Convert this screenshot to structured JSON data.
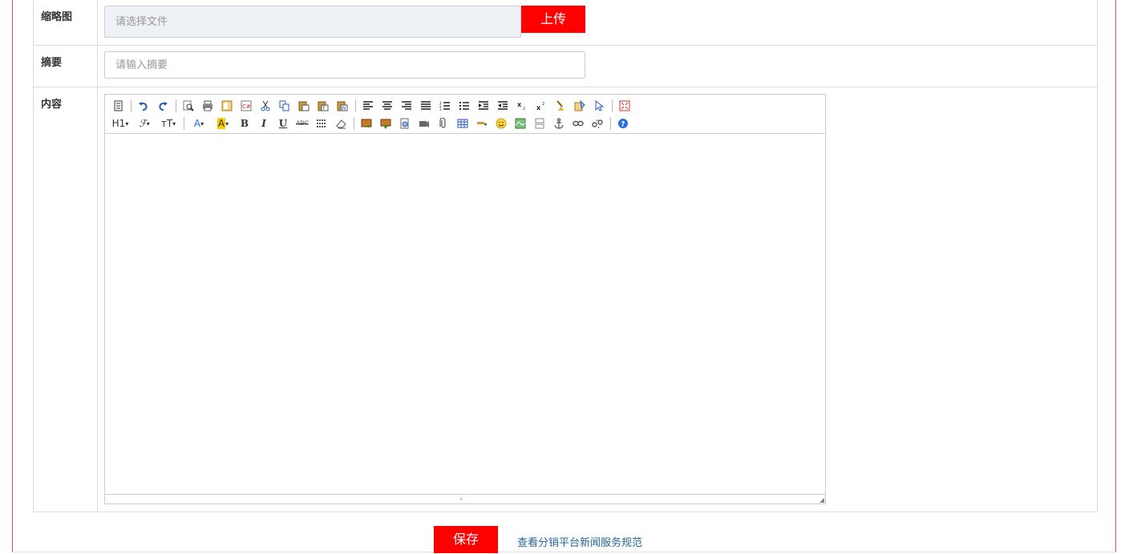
{
  "form": {
    "thumbnail": {
      "label": "缩略图",
      "placeholder": "请选择文件",
      "upload_label": "上传"
    },
    "summary": {
      "label": "摘要",
      "placeholder": "请输入摘要"
    },
    "content": {
      "label": "内容"
    }
  },
  "editor": {
    "toolbar_row1": [
      "source-icon",
      "undo-icon",
      "redo-icon",
      "preview-icon",
      "print-icon",
      "template-icon",
      "code-icon",
      "cut-icon",
      "copy-icon",
      "paste-icon",
      "paste-text-icon",
      "paste-word-icon",
      "align-left-icon",
      "align-center-icon",
      "align-right-icon",
      "justify-icon",
      "ordered-list-icon",
      "unordered-list-icon",
      "indent-icon",
      "outdent-icon",
      "subscript-icon",
      "superscript-icon",
      "clear-format-icon",
      "quick-format-icon",
      "select-all-icon",
      "fullscreen-icon"
    ],
    "toolbar_row2": [
      "heading-icon",
      "font-family-icon",
      "font-size-icon",
      "text-color-icon",
      "highlight-color-icon",
      "bold-icon",
      "italic-icon",
      "underline-icon",
      "strikethrough-icon",
      "line-height-icon",
      "eraser-icon",
      "image-icon",
      "multi-image-icon",
      "flash-icon",
      "media-icon",
      "attachment-icon",
      "table-icon",
      "horizontal-rule-icon",
      "emoticon-icon",
      "baidu-map-icon",
      "page-break-icon",
      "anchor-icon",
      "link-icon",
      "unlink-icon",
      "help-icon"
    ],
    "heading_label": "H1",
    "font_label": "ℱ",
    "size_label": "тT",
    "color_label": "A",
    "highlight_label": "A",
    "bold_label": "B",
    "italic_label": "I",
    "underline_label": "U",
    "strike_label": "ABC"
  },
  "actions": {
    "save_label": "保存",
    "link_text": "查看分销平台新闻服务规范"
  },
  "colors": {
    "primary": "#ff0000",
    "link": "#2a6496",
    "border": "#dddddd"
  }
}
